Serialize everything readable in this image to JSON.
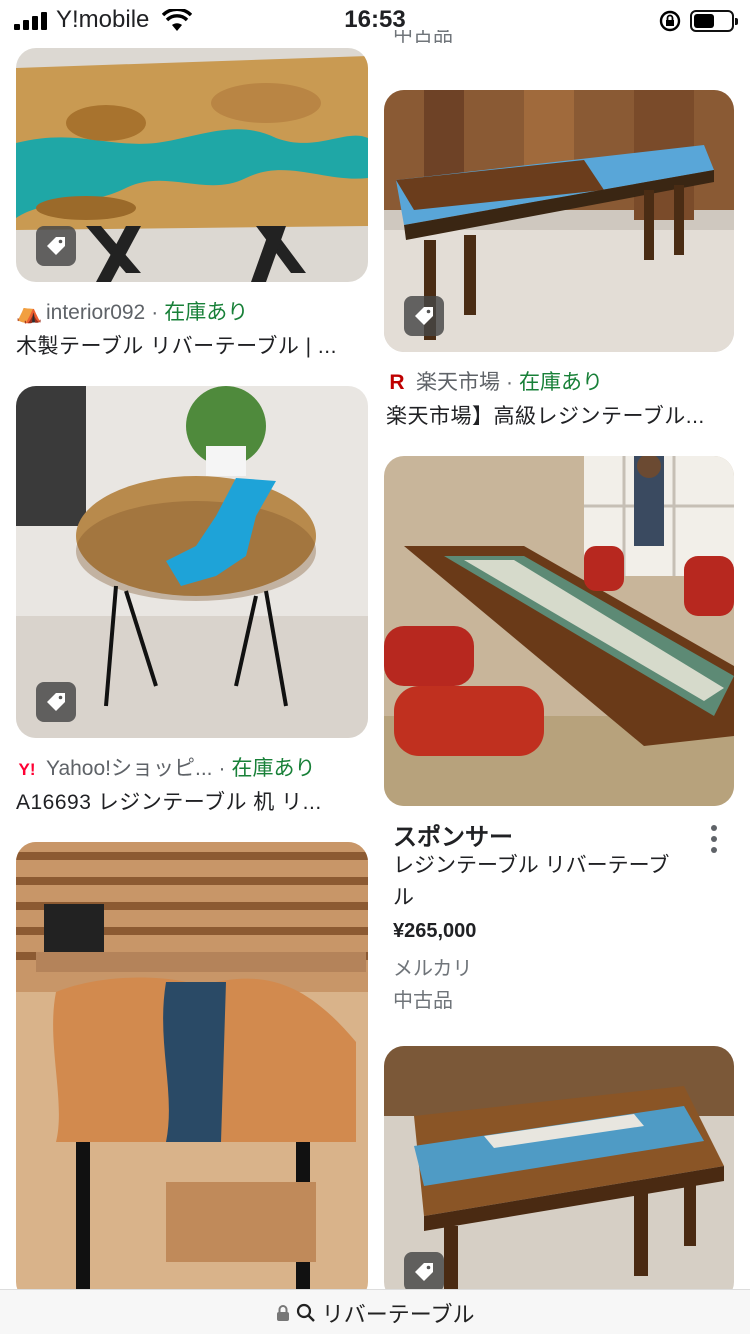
{
  "status_bar": {
    "carrier": "Y!mobile",
    "time": "16:53",
    "battery_level": 0.55
  },
  "results": {
    "top_right_cut_text": "中古品",
    "card1": {
      "source": "interior092",
      "availability": "在庫あり",
      "title": "木製テーブル リバーテーブル | ..."
    },
    "card2": {
      "source": "楽天市場",
      "availability": "在庫あり",
      "title": "楽天市場】高級レジンテーブル..."
    },
    "card3": {
      "source": "Yahoo!ショッピ...",
      "availability": "在庫あり",
      "title": "A16693 レジンテーブル 机 リ..."
    },
    "sponsored": {
      "heading": "スポンサー",
      "title": "レジンテーブル リバーテーブル",
      "price": "¥265,000",
      "seller": "メルカリ",
      "condition": "中古品"
    }
  },
  "url_bar": {
    "query": "リバーテーブル"
  },
  "colors": {
    "stock_green": "#188038",
    "muted_text": "#5f6368",
    "rakuten_red": "#bf0000",
    "yahoo_red": "#ff0033"
  }
}
